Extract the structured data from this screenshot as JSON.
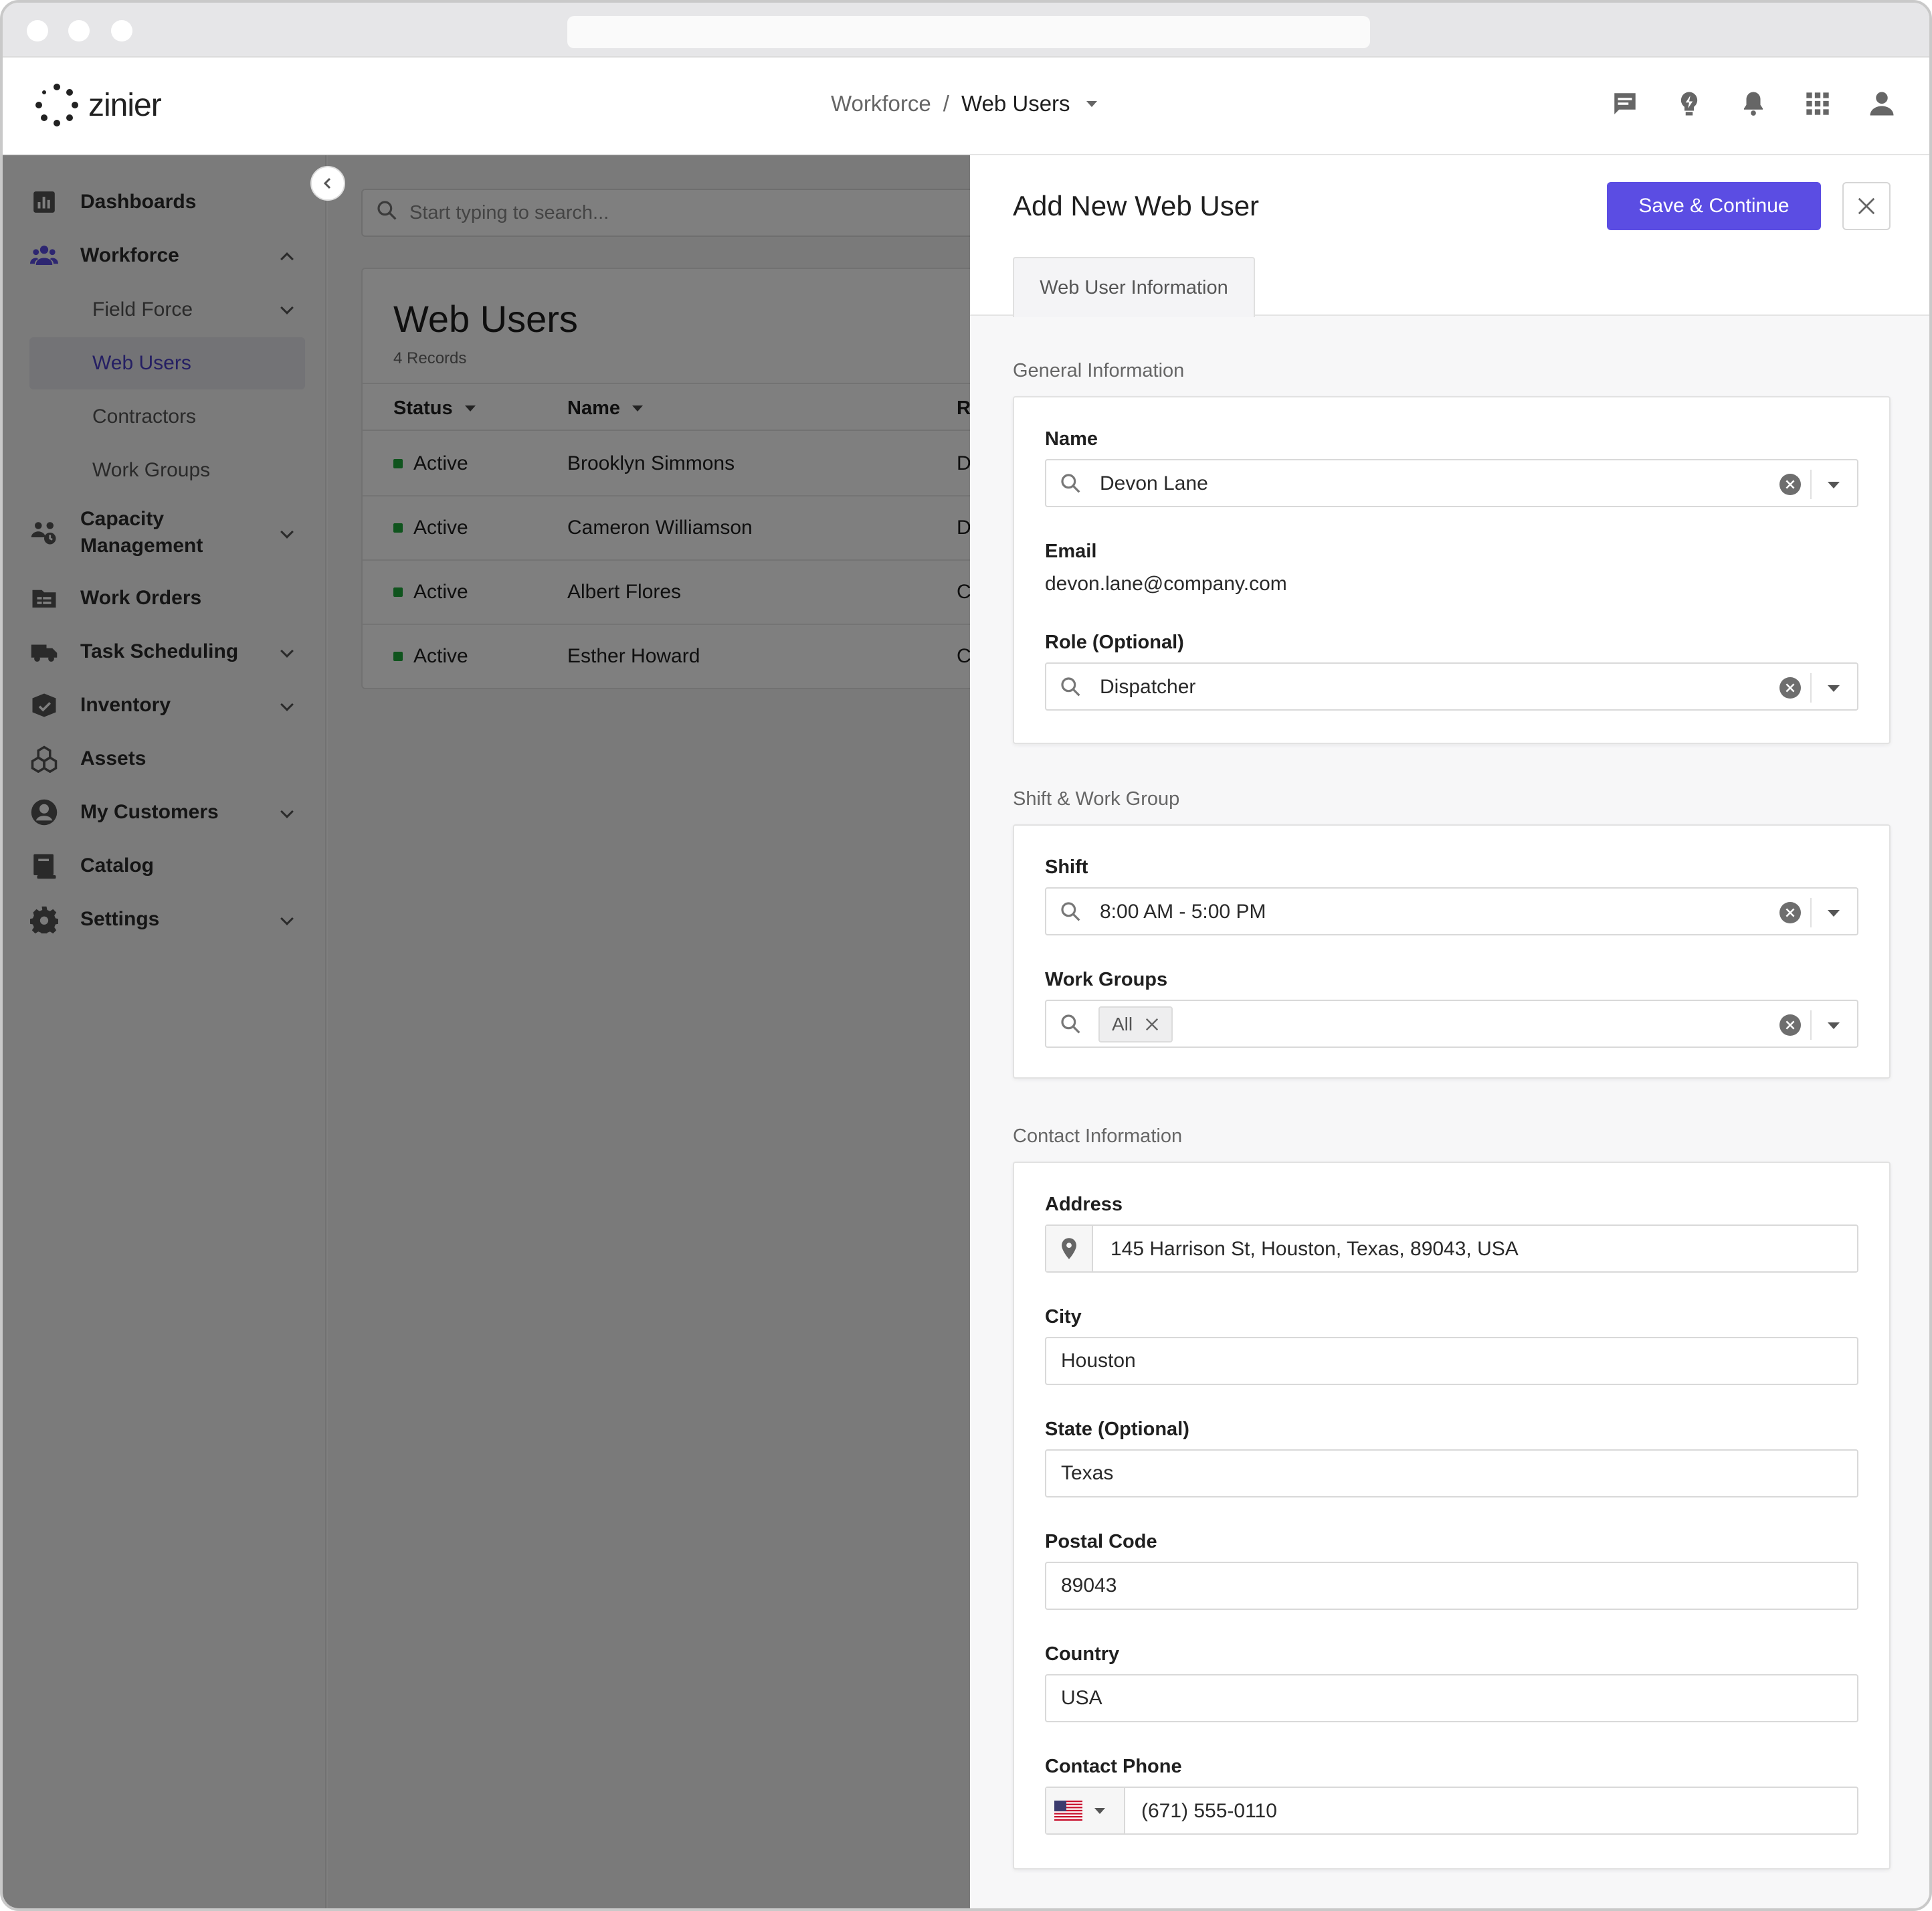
{
  "app": {
    "logo_text": "zinier"
  },
  "breadcrumb": {
    "root": "Workforce",
    "separator": "/",
    "current": "Web Users"
  },
  "top_icons": [
    "chat-icon",
    "lightbulb-icon",
    "bell-icon",
    "apps-grid-icon",
    "user-icon"
  ],
  "sidebar": {
    "items": [
      {
        "label": "Dashboards",
        "icon": "dashboard-icon"
      },
      {
        "label": "Workforce",
        "icon": "people-icon",
        "expanded": true
      },
      {
        "label": "Field Force",
        "sub": true
      },
      {
        "label": "Web Users",
        "sub": true,
        "active": true
      },
      {
        "label": "Contractors",
        "sub": true
      },
      {
        "label": "Work Groups",
        "sub": true
      },
      {
        "label": "Capacity",
        "label2": "Management",
        "icon": "capacity-icon"
      },
      {
        "label": "Work Orders",
        "icon": "work-orders-icon"
      },
      {
        "label": "Task Scheduling",
        "icon": "truck-icon"
      },
      {
        "label": "Inventory",
        "icon": "inventory-icon"
      },
      {
        "label": "Assets",
        "icon": "assets-icon"
      },
      {
        "label": "My Customers",
        "icon": "customer-icon"
      },
      {
        "label": "Catalog",
        "icon": "catalog-icon"
      },
      {
        "label": "Settings",
        "icon": "gear-icon"
      }
    ]
  },
  "main": {
    "search_placeholder": "Start typing to search...",
    "title": "Web Users",
    "record_count": "4 Records",
    "columns": [
      "Status",
      "Name",
      "Ro"
    ],
    "rows": [
      {
        "status": "Active",
        "name": "Brooklyn Simmons",
        "role": "D"
      },
      {
        "status": "Active",
        "name": "Cameron Williamson",
        "role": "D"
      },
      {
        "status": "Active",
        "name": "Albert Flores",
        "role": "Co"
      },
      {
        "status": "Active",
        "name": "Esther Howard",
        "role": "Co"
      }
    ]
  },
  "panel": {
    "title": "Add New Web User",
    "save_label": "Save &  Continue",
    "tab_label": "Web User Information",
    "general": {
      "section": "General Information",
      "name_label": "Name",
      "name_value": "Devon Lane",
      "email_label": "Email",
      "email_value": "devon.lane@company.com",
      "role_label": "Role (Optional)",
      "role_value": "Dispatcher"
    },
    "shift": {
      "section": "Shift & Work Group",
      "shift_label": "Shift",
      "shift_value": "8:00 AM - 5:00 PM",
      "groups_label": "Work Groups",
      "groups_chip": "All"
    },
    "contact": {
      "section": "Contact Information",
      "address_label": "Address",
      "address_value": "145 Harrison St, Houston, Texas, 89043, USA",
      "city_label": "City",
      "city_value": "Houston",
      "state_label": "State (Optional)",
      "state_value": "Texas",
      "postal_label": "Postal Code",
      "postal_value": "89043",
      "country_label": "Country",
      "country_value": "USA",
      "phone_label": "Contact Phone",
      "phone_value": "(671) 555-0110"
    }
  },
  "colors": {
    "accent": "#5b4de3",
    "active_nav": "#4a3fc7",
    "status_active": "#1fa83a"
  }
}
